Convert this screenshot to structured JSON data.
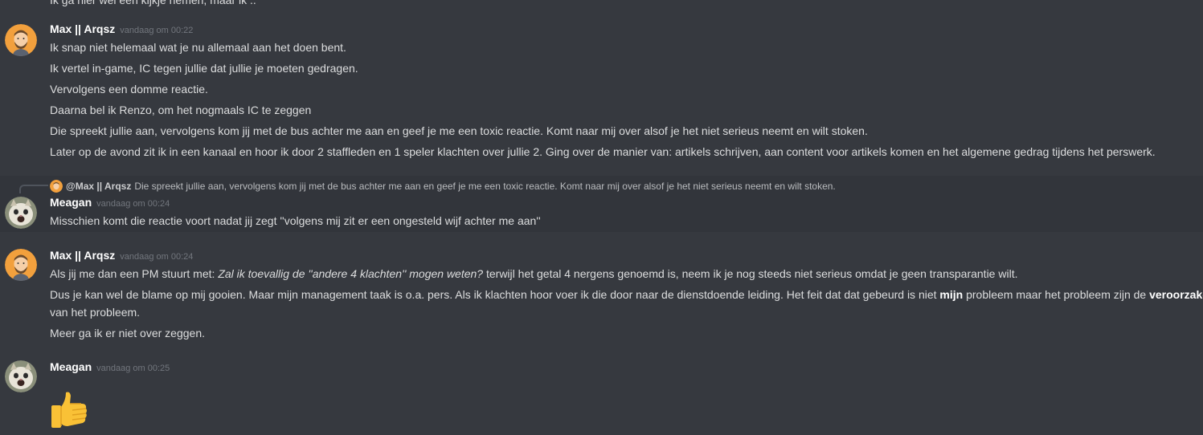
{
  "cut_line": "Ik ga hier wel een kijkje nemen, maar ik ..",
  "messages": [
    {
      "user": "Max || Arqsz",
      "time": "vandaag om 00:22",
      "lines": [
        "Ik snap niet helemaal wat je nu allemaal aan het doen bent.",
        "Ik vertel in-game, IC tegen jullie dat jullie je moeten gedragen.",
        "Vervolgens een domme reactie.",
        "Daarna bel ik Renzo, om het nogmaals IC te zeggen",
        "Die spreekt jullie aan, vervolgens kom jij met de bus achter me aan en geef je me een toxic reactie. Komt naar mij over alsof je het niet serieus neemt en wilt stoken.",
        "Later op de avond zit ik in een kanaal en hoor ik door 2 staffleden en 1 speler klachten over jullie 2. Ging over de manier van: artikels schrijven, aan content voor artikels komen en het algemene gedrag tijdens het perswerk."
      ]
    },
    {
      "reply_to_user": "@Max || Arqsz",
      "reply_text": "Die spreekt jullie aan, vervolgens kom jij met de bus achter me aan en geef je me een toxic reactie. Komt naar mij over alsof je het niet serieus neemt en wilt stoken.",
      "user": "Meagan",
      "time": "vandaag om 00:24",
      "lines": [
        "Misschien komt die reactie voort nadat jij zegt ''volgens mij zit er een ongesteld wijf achter me aan''"
      ]
    },
    {
      "user": "Max || Arqsz",
      "time": "vandaag om 00:24",
      "line1_pre": "Als jij me dan een PM stuurt met: ",
      "line1_em": "Zal ik toevallig de ''andere 4 klachten'' mogen weten?",
      "line1_post": " terwijl het getal 4 nergens genoemd is, neem ik je nog steeds niet serieus omdat je geen transparantie wilt.",
      "line2_pre": "Dus je kan wel de blame op mij gooien. Maar mijn management taak is o.a. pers. Als ik klachten hoor voer ik die door naar de dienstdoende leiding. Het feit dat dat gebeurd is niet ",
      "line2_bold1": "mijn",
      "line2_mid": " probleem maar het probleem zijn de ",
      "line2_bold2": "veroorzakers",
      "line2_post": " van het probleem.",
      "line3": "Meer ga ik er niet over zeggen."
    },
    {
      "user": "Meagan",
      "time": "vandaag om 00:25",
      "emoji": "thumbs-up"
    }
  ],
  "colors": {
    "background": "#36393f",
    "text": "#dcddde",
    "username": "#ffffff",
    "timestamp": "#72767d"
  }
}
